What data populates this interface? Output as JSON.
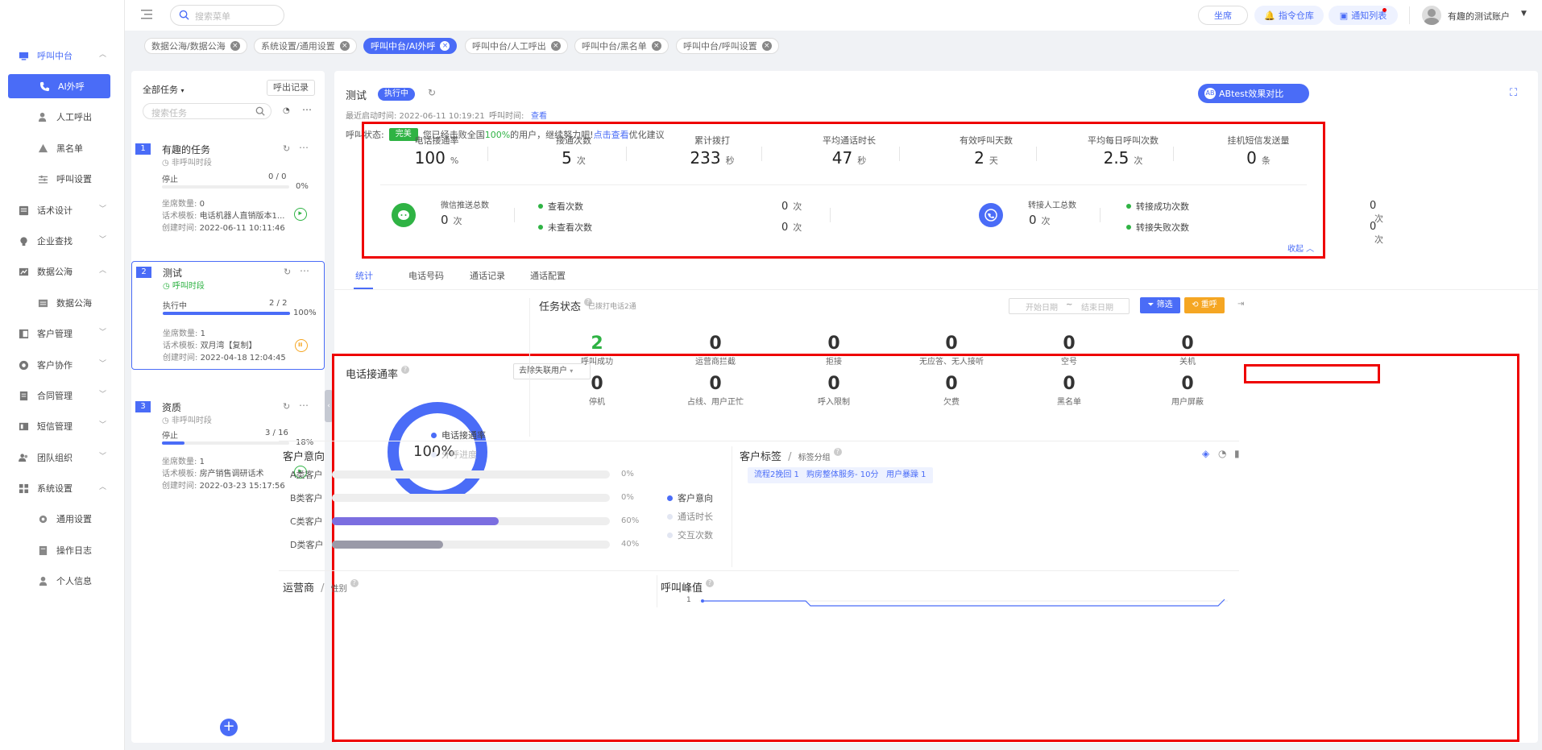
{
  "sidebar": {
    "items": [
      {
        "label": "呼叫中台",
        "icon": "monitor-icon"
      },
      {
        "label": "AI外呼",
        "icon": "phone-icon"
      },
      {
        "label": "人工呼出",
        "icon": "user-icon"
      },
      {
        "label": "黑名单",
        "icon": "warning-icon"
      },
      {
        "label": "呼叫设置",
        "icon": "sliders-icon"
      },
      {
        "label": "话术设计",
        "icon": "script-icon"
      },
      {
        "label": "企业查找",
        "icon": "bulb-icon"
      },
      {
        "label": "数据公海",
        "icon": "chart-icon"
      },
      {
        "label": "数据公海",
        "icon": "table-icon"
      },
      {
        "label": "客户管理",
        "icon": "customer-icon"
      },
      {
        "label": "客户协作",
        "icon": "collab-icon"
      },
      {
        "label": "合同管理",
        "icon": "contract-icon"
      },
      {
        "label": "短信管理",
        "icon": "sms-icon"
      },
      {
        "label": "团队组织",
        "icon": "team-icon"
      },
      {
        "label": "系统设置",
        "icon": "grid-icon"
      },
      {
        "label": "通用设置",
        "icon": "gear-icon"
      },
      {
        "label": "操作日志",
        "icon": "log-icon"
      },
      {
        "label": "个人信息",
        "icon": "person-icon"
      }
    ]
  },
  "topbar": {
    "search_placeholder": "搜索菜单",
    "seat": "坐席",
    "cmd": "指令仓库",
    "notify": "通知列表",
    "account": "有趣的测试账户"
  },
  "tabs": [
    "数据公海/数据公海",
    "系统设置/通用设置",
    "呼叫中台/AI外呼",
    "呼叫中台/人工呼出",
    "呼叫中台/黑名单",
    "呼叫中台/呼叫设置"
  ],
  "tasks": {
    "filter": "全部任务",
    "records": "呼出记录",
    "search_placeholder": "搜索任务",
    "list": [
      {
        "num": "1",
        "name": "有趣的任务",
        "period": "非呼叫时段",
        "status": "停止",
        "progress": "0 / 0",
        "pct": "0%",
        "pct_val": 0,
        "seats_k": "坐席数量:",
        "seats_v": "0",
        "tpl_k": "话术模板:",
        "tpl_v": "电话机器人直销版本1...",
        "created_k": "创建时间:",
        "created_v": "2022-06-11 10:11:46"
      },
      {
        "num": "2",
        "name": "测试",
        "period": "呼叫时段",
        "status": "执行中",
        "progress": "2 / 2",
        "pct": "100%",
        "pct_val": 100,
        "seats_k": "坐席数量:",
        "seats_v": "1",
        "tpl_k": "话术模板:",
        "tpl_v": "双月湾【复制】",
        "created_k": "创建时间:",
        "created_v": "2022-04-18 12:04:45"
      },
      {
        "num": "3",
        "name": "资质",
        "period": "非呼叫时段",
        "status": "停止",
        "progress": "3 / 16",
        "pct": "18%",
        "pct_val": 18,
        "seats_k": "坐席数量:",
        "seats_v": "1",
        "tpl_k": "话术模板:",
        "tpl_v": "房产销售调研话术",
        "created_k": "创建时间:",
        "created_v": "2022-03-23 15:17:56"
      }
    ]
  },
  "detail": {
    "title": "测试",
    "status_badge": "执行中",
    "ab_btn": "ABtest效果对比",
    "last_start": "最近启动时间: 2022-06-11 10:19:21",
    "call_time_k": "呼叫时间:",
    "call_time_v": "查看",
    "call_state_k": "呼叫状态:",
    "call_state_badge": "完美",
    "call_state_msg1": "您已经击败全国",
    "call_state_pct": "100%",
    "call_state_msg2": "的用户，继续努力吧!",
    "call_state_link": "点击查看",
    "call_state_tail": "优化建议"
  },
  "stats": [
    {
      "label": "电话接通率",
      "value": "100",
      "unit": "%"
    },
    {
      "label": "接通次数",
      "value": "5",
      "unit": "次"
    },
    {
      "label": "累计拨打",
      "value": "233",
      "unit": "秒"
    },
    {
      "label": "平均通话时长",
      "value": "47",
      "unit": "秒"
    },
    {
      "label": "有效呼叫天数",
      "value": "2",
      "unit": "天"
    },
    {
      "label": "平均每日呼叫次数",
      "value": "2.5",
      "unit": "次"
    },
    {
      "label": "挂机短信发送量",
      "value": "0",
      "unit": "条"
    }
  ],
  "wechat": {
    "label": "微信推送总数",
    "value": "0",
    "unit": "次",
    "view_label": "查看次数",
    "view_val": "0",
    "view_unit": "次",
    "unview_label": "未查看次数",
    "unview_val": "0",
    "unview_unit": "次"
  },
  "transfer": {
    "label": "转接人工总数",
    "value": "0",
    "unit": "次",
    "ok_label": "转接成功次数",
    "ok_val": "0",
    "ok_unit": "次",
    "fail_label": "转接失败次数",
    "fail_val": "0",
    "fail_unit": "次"
  },
  "collapse": "收起",
  "subtabs": [
    "统计",
    "电话号码",
    "通话记录",
    "通话配置"
  ],
  "connect": {
    "title": "电话接通率",
    "select": "去除失联用户",
    "pct": "100%",
    "pct_val": 100,
    "legend1": "电话接通率",
    "legend2": "外呼进度"
  },
  "task_state": {
    "title": "任务状态",
    "sub": "已拨打电话2通",
    "start_ph": "开始日期",
    "tilde": "~",
    "end_ph": "结束日期",
    "filter_btn": "筛选",
    "reset_btn": "重呼",
    "items": [
      {
        "num": "2",
        "label": "呼叫成功"
      },
      {
        "num": "0",
        "label": "运营商拦截"
      },
      {
        "num": "0",
        "label": "拒接"
      },
      {
        "num": "0",
        "label": "无应答、无人接听"
      },
      {
        "num": "0",
        "label": "空号"
      },
      {
        "num": "0",
        "label": "关机"
      },
      {
        "num": "0",
        "label": "停机"
      },
      {
        "num": "0",
        "label": "占线、用户正忙"
      },
      {
        "num": "0",
        "label": "呼入限制"
      },
      {
        "num": "0",
        "label": "欠费"
      },
      {
        "num": "0",
        "label": "黑名单"
      },
      {
        "num": "0",
        "label": "用户屏蔽"
      }
    ]
  },
  "intent": {
    "title": "客户意向",
    "rows": [
      {
        "label": "A类客户",
        "pct": "0%",
        "val": 0,
        "color": "#7b6ee0"
      },
      {
        "label": "B类客户",
        "pct": "0%",
        "val": 0,
        "color": "#7b6ee0"
      },
      {
        "label": "C类客户",
        "pct": "60%",
        "val": 60,
        "color": "#7b6ee0"
      },
      {
        "label": "D类客户",
        "pct": "40%",
        "val": 40,
        "color": "#9a9aa8"
      }
    ],
    "legend": [
      "客户意向",
      "通话时长",
      "交互次数"
    ]
  },
  "tags": {
    "title": "客户标签",
    "sep": "/",
    "sub": "标签分组",
    "items": [
      "流程2挽回 1",
      "购房整体服务- 10分 1",
      "用户暴躁 1"
    ]
  },
  "carrier": {
    "title": "运营商",
    "sep": "/",
    "sub": "性别"
  },
  "peak": {
    "title": "呼叫峰值",
    "y1": "1"
  },
  "colors": {
    "primary": "#4a6cf7",
    "green": "#2fb344",
    "orange": "#f5a623",
    "red": "#e00000"
  }
}
